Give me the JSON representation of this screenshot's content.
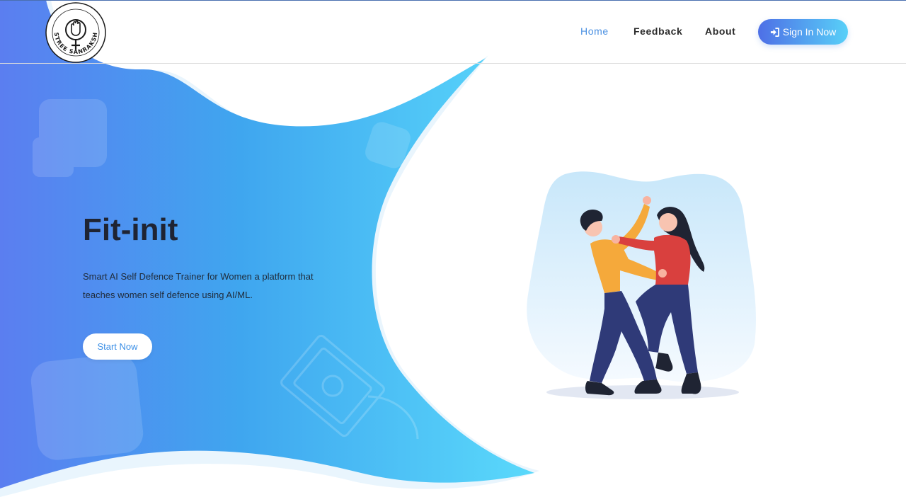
{
  "nav": {
    "logo_text": "STREE SANRAKSHAN",
    "links": [
      {
        "label": "Home",
        "active": true
      },
      {
        "label": "Feedback",
        "active": false
      },
      {
        "label": "About",
        "active": false
      }
    ],
    "signin_label": "Sign In Now",
    "signin_icon": "sign-in-icon"
  },
  "hero": {
    "title": "Fit-init",
    "description": "Smart AI Self Defence Trainer for Women a platform that teaches women self defence using AI/ML.",
    "cta_label": "Start Now",
    "illustration": "self-defence-illustration"
  },
  "colors": {
    "gradient_start": "#4e6fe6",
    "gradient_end": "#58d0f8",
    "active_link": "#4a90e2",
    "title": "#1f2433"
  }
}
